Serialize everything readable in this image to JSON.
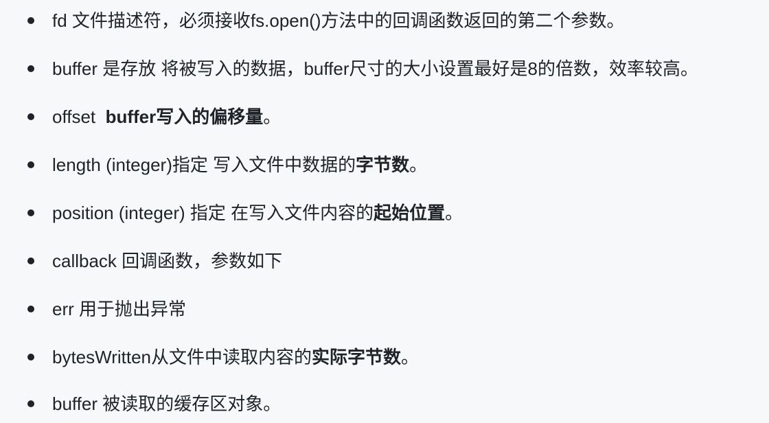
{
  "items": [
    {
      "parts": [
        {
          "text": "fd 文件描述符，必须接收fs.open()方法中的回调函数返回的第二个参数。",
          "bold": false
        }
      ]
    },
    {
      "parts": [
        {
          "text": "buffer 是存放 将被写入的数据，buffer尺寸的大小设置最好是8的倍数，效率较高。",
          "bold": false
        }
      ]
    },
    {
      "parts": [
        {
          "text": "offset  ",
          "bold": false
        },
        {
          "text": "buffer写入的偏移量",
          "bold": true
        },
        {
          "text": "。",
          "bold": false
        }
      ]
    },
    {
      "parts": [
        {
          "text": "length (integer)指定 写入文件中数据的",
          "bold": false
        },
        {
          "text": "字节数",
          "bold": true
        },
        {
          "text": "。",
          "bold": false
        }
      ]
    },
    {
      "parts": [
        {
          "text": "position (integer) 指定 在写入文件内容的",
          "bold": false
        },
        {
          "text": "起始位置",
          "bold": true
        },
        {
          "text": "。",
          "bold": false
        }
      ]
    },
    {
      "parts": [
        {
          "text": "callback 回调函数，参数如下",
          "bold": false
        }
      ]
    },
    {
      "parts": [
        {
          "text": "err 用于抛出异常",
          "bold": false
        }
      ]
    },
    {
      "parts": [
        {
          "text": "bytesWritten从文件中读取内容的",
          "bold": false
        },
        {
          "text": "实际字节数",
          "bold": true
        },
        {
          "text": "。",
          "bold": false
        }
      ]
    },
    {
      "parts": [
        {
          "text": "buffer 被读取的缓存区对象。",
          "bold": false
        }
      ]
    }
  ]
}
